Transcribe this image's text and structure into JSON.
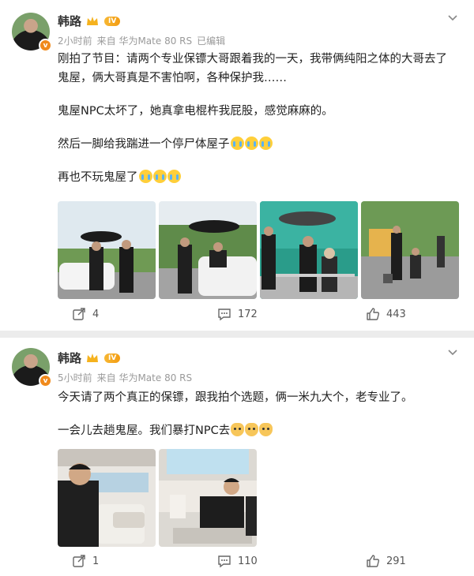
{
  "posts": [
    {
      "author": "韩路",
      "level": "IV",
      "time": "2小时前",
      "source": "来自 华为Mate 80 RS",
      "edited": "已编辑",
      "paragraphs": [
        "刚拍了节目：请两个专业保镖大哥跟着我的一天，我带俩纯阳之体的大哥去了鬼屋，俩大哥真是不害怕啊，各种保护我……",
        "鬼屋NPC太坏了，她真拿电棍杵我屁股，感觉麻麻的。",
        "然后一脚给我踹进一个停尸体屋子",
        "再也不玩鬼屋了"
      ],
      "emoji": [
        "crying-face-emoji",
        "crying-face-emoji",
        "crying-face-emoji"
      ],
      "photos": [
        "bodyguards-umbrella-white-car",
        "bodyguards-umbrella-car-door",
        "bodyguards-umbrella-green-building",
        "bodyguards-street-scene"
      ],
      "reposts": "4",
      "comments": "172",
      "likes": "443"
    },
    {
      "author": "韩路",
      "level": "IV",
      "time": "5小时前",
      "source": "来自 华为Mate 80 RS",
      "paragraphs": [
        "今天请了两个真正的保镖，跟我拍个选题，俩一米九大个，老专业了。",
        "一会儿去趟鬼屋。我们暴打NPC去"
      ],
      "emoji": [
        "doge-emoji",
        "doge-emoji",
        "doge-emoji"
      ],
      "photos": [
        "man-in-car-front-seat",
        "two-men-in-car-interior"
      ],
      "reposts": "1",
      "comments": "110",
      "likes": "291"
    }
  ],
  "colors": {
    "accent": "#f08a1c",
    "meta_text": "#9a9a9a",
    "divider": "#ececec"
  }
}
